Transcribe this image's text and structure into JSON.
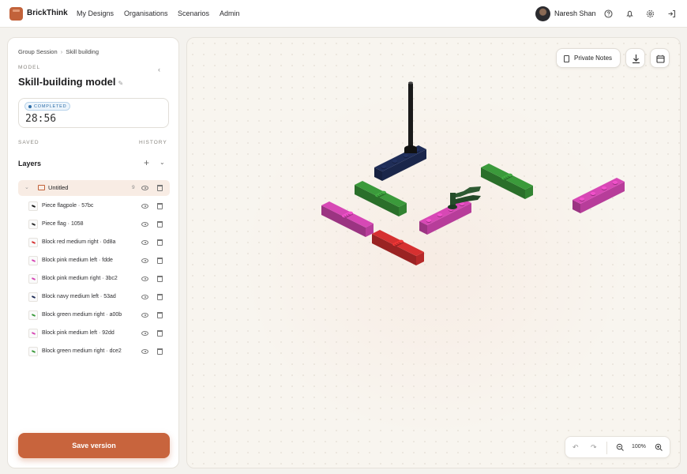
{
  "app": {
    "brand": "BrickThink"
  },
  "nav": {
    "items": [
      "My Designs",
      "Organisations",
      "Scenarios",
      "Admin"
    ]
  },
  "user": {
    "name": "Naresh Shan"
  },
  "header_icons": [
    "help-circle-icon",
    "bell-icon",
    "gear-icon",
    "logout-icon"
  ],
  "panel": {
    "breadcrumb": {
      "parent": "Group Session",
      "separator": "›",
      "current": "Skill building"
    },
    "section_label": "MODEL",
    "model_title": "Skill-building model",
    "status": "COMPLETED",
    "timer": "28:56",
    "saved_label": "SAVED",
    "history_label": "HISTORY",
    "layers_title": "Layers",
    "group": {
      "name": "Untitled",
      "count": "9"
    },
    "layers": [
      {
        "name": "Piece flagpole · 57bc",
        "color": "#1a1a1a"
      },
      {
        "name": "Piece flag · 1058",
        "color": "#2a2a2a"
      },
      {
        "name": "Block red medium right · 0d8a",
        "color": "#d63030"
      },
      {
        "name": "Block pink medium left · fdde",
        "color": "#d748b5"
      },
      {
        "name": "Block pink medium right · 3bc2",
        "color": "#d748b5"
      },
      {
        "name": "Block navy medium left · 53ad",
        "color": "#1f2d57"
      },
      {
        "name": "Block green medium right · a00b",
        "color": "#3b9a3b"
      },
      {
        "name": "Block pink medium left · 92dd",
        "color": "#d748b5"
      },
      {
        "name": "Block green medium right · dce2",
        "color": "#3b9a3b"
      }
    ],
    "save_button": "Save version"
  },
  "canvas": {
    "private_notes": "Private Notes",
    "zoom": "100%"
  },
  "colors": {
    "accent": "#c8643d",
    "red": "#d63030",
    "pink": "#d748b5",
    "green": "#3b9a3b",
    "navy": "#1f2d57",
    "black": "#1a1a1a",
    "dark_green": "#254d2a"
  }
}
